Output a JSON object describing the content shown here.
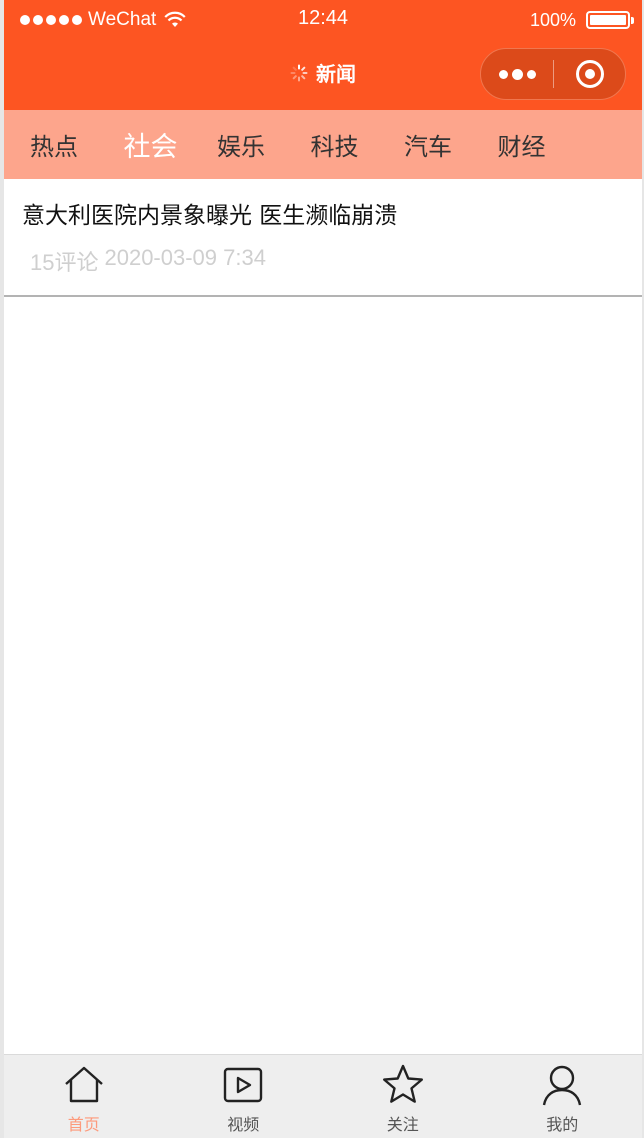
{
  "status_bar": {
    "carrier": "WeChat",
    "time": "12:44",
    "battery": "100%"
  },
  "nav": {
    "title": "新闻"
  },
  "categories": [
    {
      "label": "热点"
    },
    {
      "label": "社会",
      "active": true
    },
    {
      "label": "娱乐"
    },
    {
      "label": "科技"
    },
    {
      "label": "汽车"
    },
    {
      "label": "财经"
    }
  ],
  "articles": [
    {
      "title": "意大利医院内景象曝光 医生濒临崩溃",
      "comments": "15评论",
      "time": "2020-03-09 7:34"
    }
  ],
  "tabbar": [
    {
      "label": "首页",
      "icon": "home-icon",
      "active": true
    },
    {
      "label": "视频",
      "icon": "video-icon"
    },
    {
      "label": "关注",
      "icon": "star-icon"
    },
    {
      "label": "我的",
      "icon": "user-icon"
    }
  ],
  "colors": {
    "brand": "#fd5522",
    "tabs_bg": "#fda58c",
    "active_tab_label": "#fd9a7c"
  }
}
